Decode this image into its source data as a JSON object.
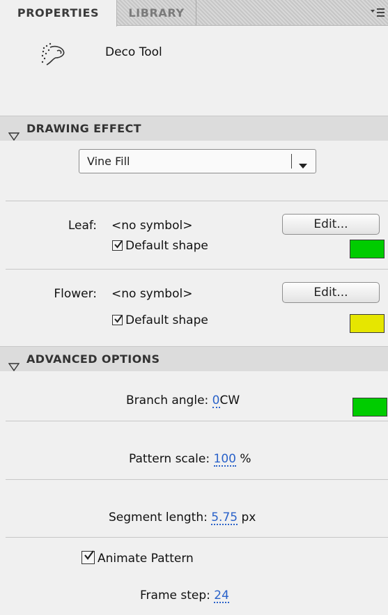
{
  "tabs": [
    {
      "label": "PROPERTIES",
      "active": true
    },
    {
      "label": "LIBRARY",
      "active": false
    }
  ],
  "tool": {
    "name": "Deco Tool",
    "icon": "deco-spray-icon"
  },
  "drawing_effect": {
    "header": "DRAWING EFFECT",
    "selected": "Vine Fill"
  },
  "leaf": {
    "label": "Leaf:",
    "symbol": "<no symbol>",
    "edit_label": "Edit...",
    "default_shape_label": "Default shape",
    "default_shape_checked": true,
    "color": "#00cc00"
  },
  "flower": {
    "label": "Flower:",
    "symbol": "<no symbol>",
    "edit_label": "Edit...",
    "default_shape_label": "Default shape",
    "default_shape_checked": true,
    "color": "#e6e600"
  },
  "advanced": {
    "header": "ADVANCED OPTIONS",
    "branch_angle": {
      "label": "Branch angle:",
      "value": "0",
      "unit": "CW",
      "color": "#00cc00"
    },
    "pattern_scale": {
      "label": "Pattern scale:",
      "value": "100",
      "unit": "%"
    },
    "segment_length": {
      "label": "Segment length:",
      "value": "5.75",
      "unit": "px"
    },
    "animate_pattern": {
      "label": "Animate Pattern",
      "checked": true
    },
    "frame_step": {
      "label": "Frame step:",
      "value": "24"
    }
  }
}
